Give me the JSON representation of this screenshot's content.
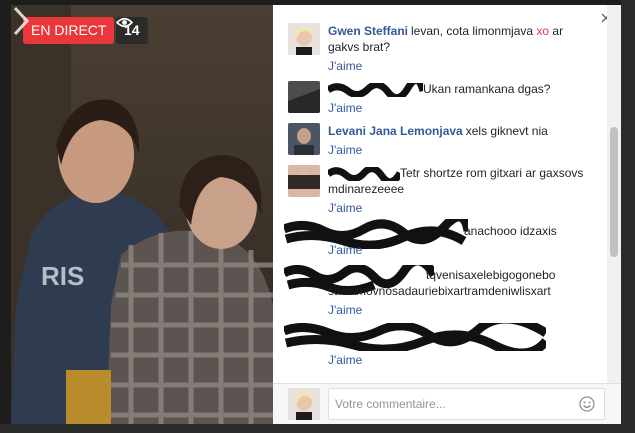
{
  "video": {
    "live_label": "EN DIRECT",
    "viewer_count": "14"
  },
  "icons": {
    "eye": "eye-icon",
    "next": "chevron-right-icon",
    "close": "close-icon",
    "smiley": "smiley-icon"
  },
  "colors": {
    "live": "#e9373c",
    "link": "#365899"
  },
  "comments": [
    {
      "author": "Gwen Steffani",
      "text_a": "levan, cota limonmjava ",
      "text_hl": "xo",
      "text_b": " ar gakvs brat?",
      "like": "J'aime",
      "author_redacted": false
    },
    {
      "author": "",
      "text_a": "Ukan ramankana dgas?",
      "text_hl": "",
      "text_b": "",
      "like": "J'aime",
      "author_redacted": true
    },
    {
      "author": "Levani Jana Lemonjava",
      "text_a": "xels giknevt nia",
      "text_hl": "",
      "text_b": "",
      "like": "J'aime",
      "author_redacted": false
    },
    {
      "author": "",
      "text_a": "Tetr shortze rom gitxari ar gaxsovs mdinarezeeee",
      "text_hl": "",
      "text_b": "",
      "like": "J'aime",
      "author_redacted": true
    },
    {
      "author": "",
      "text_a": "anachooo idzaxis",
      "text_hl": "",
      "text_b": "",
      "like": "J'aime",
      "author_redacted": true
    },
    {
      "author": "",
      "text_a": "tqvenisaxelebigogonebo sasiamovnosadauriebixartramdeniwlisxart",
      "text_hl": "",
      "text_b": "",
      "like": "J'aime",
      "author_redacted": true
    },
    {
      "author": "",
      "text_a": "",
      "text_hl": "",
      "text_b": "",
      "like": "J'aime",
      "author_redacted": true
    }
  ],
  "composer": {
    "placeholder": "Votre commentaire..."
  }
}
